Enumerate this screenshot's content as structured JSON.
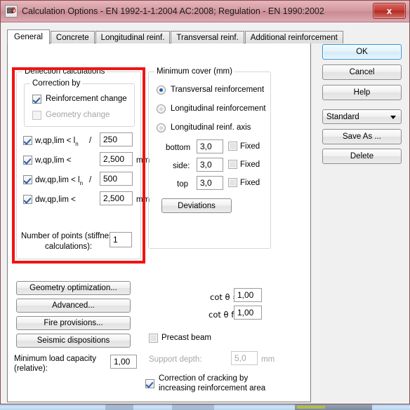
{
  "window": {
    "title": "Calculation Options - EN 1992-1-1:2004 AC:2008;   Regulation - EN 1990:2002",
    "icon": "app-box-icon",
    "close_label": "x"
  },
  "tabs": [
    {
      "label": "General",
      "active": true
    },
    {
      "label": "Concrete",
      "active": false
    },
    {
      "label": "Longitudinal reinf.",
      "active": false
    },
    {
      "label": "Transversal reinf.",
      "active": false
    },
    {
      "label": "Additional reinforcement",
      "active": false
    }
  ],
  "deflection": {
    "group_title": "Deflection calculations",
    "correction_group_title": "Correction by",
    "correction_items": [
      {
        "label": "Reinforcement change",
        "checked": true,
        "enabled": true
      },
      {
        "label": "Geometry change",
        "checked": false,
        "enabled": false
      }
    ],
    "limits": [
      {
        "label_main": "w,qp,lim < l",
        "label_sub": "n",
        "slash": "/",
        "value": "250",
        "unit": "",
        "checked": true
      },
      {
        "label_main": "w,qp,lim <",
        "label_sub": "",
        "slash": "",
        "value": "2,500",
        "unit": "mm",
        "checked": true
      },
      {
        "label_main": "dw,qp,lim < l",
        "label_sub": "n",
        "slash": "/",
        "value": "500",
        "unit": "",
        "checked": true
      },
      {
        "label_main": "dw,qp,lim <",
        "label_sub": "",
        "slash": "",
        "value": "2,500",
        "unit": "mm",
        "checked": true
      }
    ],
    "points_label_line1": "Number of points (stiffness",
    "points_label_line2": "calculations):",
    "points_value": "1",
    "highlight_color": "#f01414"
  },
  "mincover": {
    "group_title": "Minimum cover (mm)",
    "options": [
      {
        "label": "Transversal reinforcement",
        "selected": true
      },
      {
        "label": "Longitudinal reinforcement",
        "selected": false
      },
      {
        "label": "Longitudinal reinf. axis",
        "selected": false
      }
    ],
    "rows": [
      {
        "label": "bottom",
        "value": "3,0",
        "fixed_label": "Fixed",
        "fixed_checked": false
      },
      {
        "label": "side:",
        "value": "3,0",
        "fixed_label": "Fixed",
        "fixed_checked": false
      },
      {
        "label": "top",
        "value": "3,0",
        "fixed_label": "Fixed",
        "fixed_checked": false
      }
    ],
    "deviations_button": "Deviations"
  },
  "actions": {
    "ok": "OK",
    "cancel": "Cancel",
    "help": "Help",
    "profile_selected": "Standard",
    "save_as": "Save As ...",
    "delete": "Delete"
  },
  "bottom_left": {
    "geometry_optimization": "Geometry optimization...",
    "advanced": "Advanced...",
    "fire_provisions": "Fire provisions...",
    "seismic_dispositions": "Seismic dispositions",
    "min_load_label_line1": "Minimum load capacity",
    "min_load_label_line2": "(relative):",
    "min_load_value": "1,00"
  },
  "bottom_right": {
    "cot_theta_label": "cot θ  =",
    "cot_theta_value": "1,00",
    "cot_theta_f_label": "cot θ f=",
    "cot_theta_f_value": "1,00",
    "precast_beam_label": "Precast beam",
    "precast_beam_checked": false,
    "support_depth_label": "Support depth:",
    "support_depth_value": "5,0",
    "support_depth_unit": "mm",
    "cracking_label_line1": "Correction of cracking by",
    "cracking_label_line2": "increasing reinforcement area",
    "cracking_checked": true
  }
}
